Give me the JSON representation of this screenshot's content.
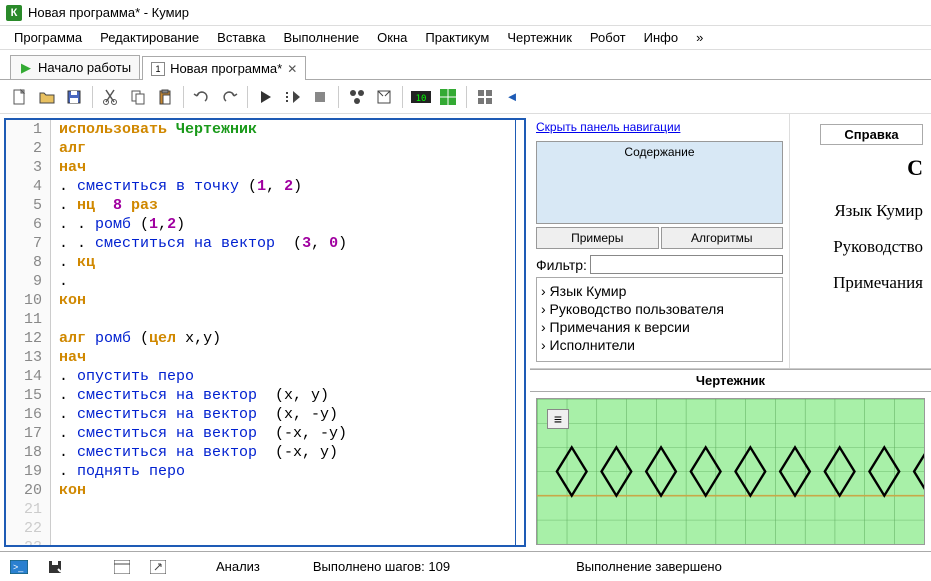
{
  "window": {
    "title": "Новая программа* - Кумир",
    "app_icon_letter": "К"
  },
  "menu": [
    "Программа",
    "Редактирование",
    "Вставка",
    "Выполнение",
    "Окна",
    "Практикум",
    "Чертежник",
    "Робот",
    "Инфо",
    "»"
  ],
  "tabs": [
    {
      "label": "Начало работы",
      "active": false,
      "closable": false
    },
    {
      "label": "Новая программа*",
      "active": true,
      "closable": true,
      "icon_text": "1"
    }
  ],
  "code": {
    "lines": [
      [
        {
          "t": "kw",
          "v": "использовать "
        },
        {
          "t": "green",
          "v": "Чертежник"
        }
      ],
      [
        {
          "t": "kw",
          "v": "алг"
        }
      ],
      [
        {
          "t": "kw",
          "v": "нач"
        }
      ],
      [
        {
          "t": "plain",
          "v": ". "
        },
        {
          "t": "cmd",
          "v": "сместиться в точку"
        },
        {
          "t": "plain",
          "v": " ("
        },
        {
          "t": "num",
          "v": "1"
        },
        {
          "t": "plain",
          "v": ", "
        },
        {
          "t": "num",
          "v": "2"
        },
        {
          "t": "plain",
          "v": ")"
        }
      ],
      [
        {
          "t": "plain",
          "v": ". "
        },
        {
          "t": "kw",
          "v": "нц  "
        },
        {
          "t": "num",
          "v": "8"
        },
        {
          "t": "kw",
          "v": " раз"
        }
      ],
      [
        {
          "t": "plain",
          "v": ". . "
        },
        {
          "t": "cmd",
          "v": "ромб"
        },
        {
          "t": "plain",
          "v": " ("
        },
        {
          "t": "num",
          "v": "1"
        },
        {
          "t": "plain",
          "v": ","
        },
        {
          "t": "num",
          "v": "2"
        },
        {
          "t": "plain",
          "v": ")"
        }
      ],
      [
        {
          "t": "plain",
          "v": ". . "
        },
        {
          "t": "cmd",
          "v": "сместиться на вектор "
        },
        {
          "t": "plain",
          "v": " ("
        },
        {
          "t": "num",
          "v": "3"
        },
        {
          "t": "plain",
          "v": ", "
        },
        {
          "t": "num",
          "v": "0"
        },
        {
          "t": "plain",
          "v": ")"
        }
      ],
      [
        {
          "t": "plain",
          "v": ". "
        },
        {
          "t": "kw",
          "v": "кц"
        }
      ],
      [
        {
          "t": "plain",
          "v": "."
        }
      ],
      [
        {
          "t": "kw",
          "v": "кон"
        }
      ],
      [],
      [
        {
          "t": "kw",
          "v": "алг "
        },
        {
          "t": "cmd",
          "v": "ромб"
        },
        {
          "t": "plain",
          "v": " ("
        },
        {
          "t": "kw",
          "v": "цел"
        },
        {
          "t": "plain",
          "v": " x,y)"
        }
      ],
      [
        {
          "t": "kw",
          "v": "нач"
        }
      ],
      [
        {
          "t": "plain",
          "v": ". "
        },
        {
          "t": "cmd",
          "v": "опустить перо"
        }
      ],
      [
        {
          "t": "plain",
          "v": ". "
        },
        {
          "t": "cmd",
          "v": "сместиться на вектор "
        },
        {
          "t": "plain",
          "v": " (x, y)"
        }
      ],
      [
        {
          "t": "plain",
          "v": ". "
        },
        {
          "t": "cmd",
          "v": "сместиться на вектор "
        },
        {
          "t": "plain",
          "v": " (x, -y)"
        }
      ],
      [
        {
          "t": "plain",
          "v": ". "
        },
        {
          "t": "cmd",
          "v": "сместиться на вектор "
        },
        {
          "t": "plain",
          "v": " (-x, -y)"
        }
      ],
      [
        {
          "t": "plain",
          "v": ". "
        },
        {
          "t": "cmd",
          "v": "сместиться на вектор "
        },
        {
          "t": "plain",
          "v": " (-x, y)"
        }
      ],
      [
        {
          "t": "plain",
          "v": ". "
        },
        {
          "t": "cmd",
          "v": "поднять перо"
        }
      ],
      [
        {
          "t": "kw",
          "v": "кон"
        }
      ],
      [],
      [],
      []
    ],
    "faded_from": 21
  },
  "nav": {
    "hide_link": "Скрыть панель навигации",
    "contents_btn": "Содержание",
    "examples_btn": "Примеры",
    "algorithms_btn": "Алгоритмы",
    "filter_label": "Фильтр:",
    "tree": [
      "Язык Кумир",
      "Руководство пользователя",
      "Примечания к версии",
      "Исполнители"
    ]
  },
  "help": {
    "panel_title": "Справка",
    "big_c": "С",
    "lines": [
      "Язык Кумир",
      "Руководство",
      "Примечания"
    ]
  },
  "drawer": {
    "title": "Чертежник"
  },
  "status": {
    "analyze": "Анализ",
    "steps": "Выполнено шагов: 109",
    "done": "Выполнение завершено"
  }
}
